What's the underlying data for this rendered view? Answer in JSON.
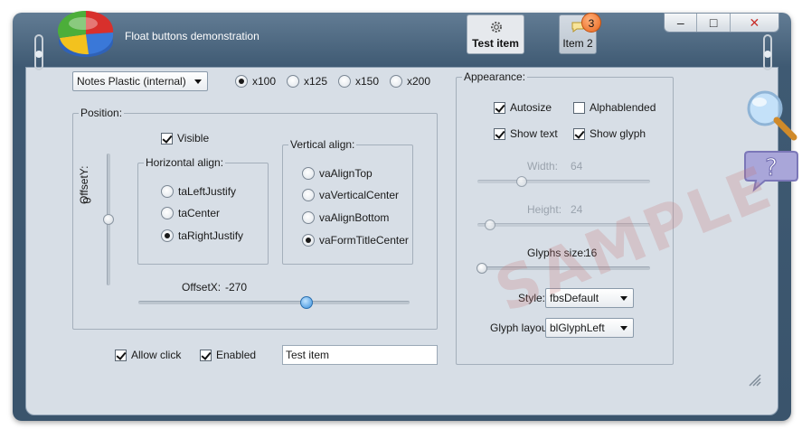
{
  "window": {
    "title": "Float buttons demonstration"
  },
  "float_buttons": [
    {
      "label": "Test item",
      "icon": "gear-icon"
    },
    {
      "label": "Item 2",
      "icon": "speech-bubble-icon",
      "badge": "3"
    }
  ],
  "system_buttons": {
    "minimize": "–",
    "maximize": "□",
    "close": "✕"
  },
  "toolbar": {
    "skin_combo": "Notes Plastic (internal)",
    "scale_options": [
      "x100",
      "x125",
      "x150",
      "x200"
    ],
    "scale_selected": "x100"
  },
  "position": {
    "caption": "Position:",
    "visible_label": "Visible",
    "visible_checked": true,
    "offset_y_label": "OffsetY:",
    "offset_y_value": "0",
    "offset_x_label": "OffsetX:",
    "offset_x_value": "-270",
    "horizontal": {
      "caption": "Horizontal align:",
      "options": [
        "taLeftJustify",
        "taCenter",
        "taRightJustify"
      ],
      "selected": "taRightJustify"
    },
    "vertical": {
      "caption": "Vertical align:",
      "options": [
        "vaAlignTop",
        "vaVerticalCenter",
        "vaAlignBottom",
        "vaFormTitleCenter"
      ],
      "selected": "vaFormTitleCenter"
    }
  },
  "bottom": {
    "allow_click_label": "Allow click",
    "allow_click_checked": true,
    "enabled_label": "Enabled",
    "enabled_checked": true,
    "caption_value": "Test item"
  },
  "appearance": {
    "caption": "Appearance:",
    "autosize_label": "Autosize",
    "autosize_checked": true,
    "alphablended_label": "Alphablended",
    "alphablended_checked": false,
    "show_text_label": "Show text",
    "show_text_checked": true,
    "show_glyph_label": "Show glyph",
    "show_glyph_checked": true,
    "width_label": "Width:",
    "width_value": "64",
    "height_label": "Height:",
    "height_value": "24",
    "glyphs_size_label": "Glyphs size:",
    "glyphs_size_value": "16",
    "style_label": "Style:",
    "style_value": "fbsDefault",
    "glyph_layout_label": "Glyph layout",
    "glyph_layout_value": "blGlyphLeft"
  },
  "watermark": "SAMPLE"
}
